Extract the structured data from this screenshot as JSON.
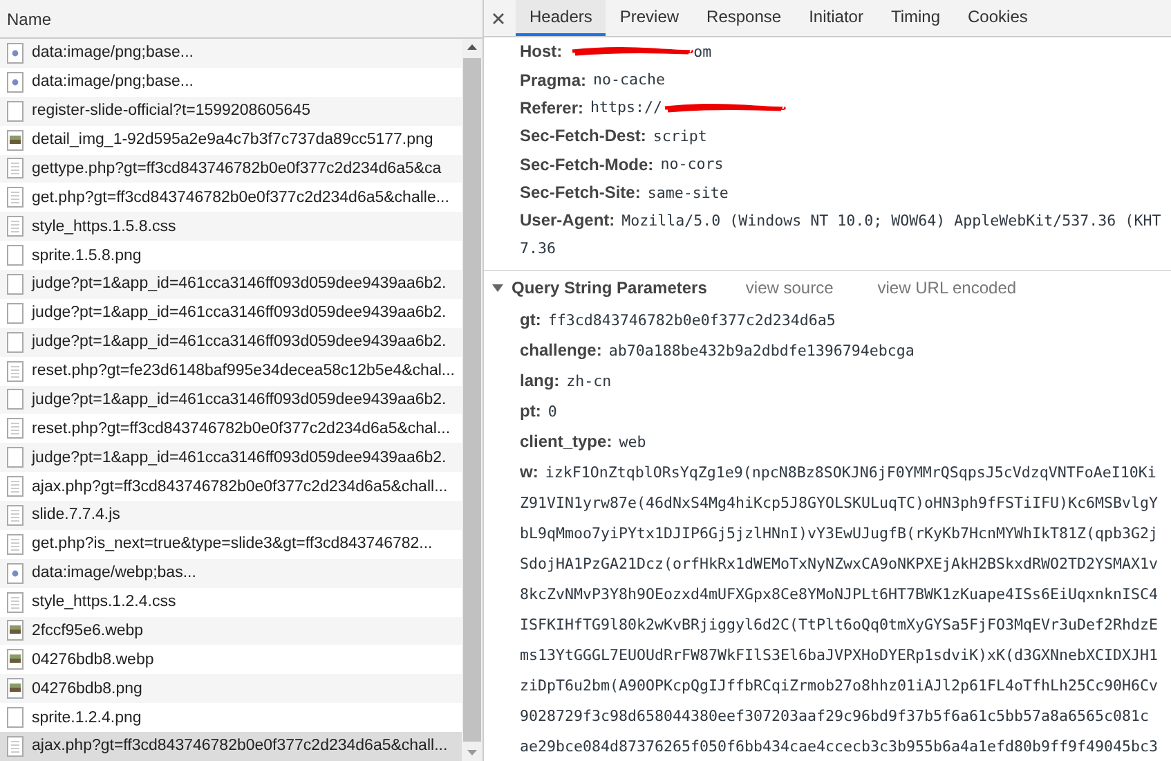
{
  "request_list": {
    "column": "Name",
    "rows": [
      {
        "name": "data:image/png;base...",
        "kind": "dot",
        "selected": false
      },
      {
        "name": "data:image/png;base...",
        "kind": "dot",
        "selected": false
      },
      {
        "name": "register-slide-official?t=1599208605645",
        "kind": "blank",
        "selected": false
      },
      {
        "name": "detail_img_1-92d595a2e9a4c7b3f7c737da89cc5177.png",
        "kind": "image",
        "selected": false
      },
      {
        "name": "gettype.php?gt=ff3cd843746782b0e0f377c2d234d6a5&ca",
        "kind": "document",
        "selected": false
      },
      {
        "name": "get.php?gt=ff3cd843746782b0e0f377c2d234d6a5&challe...",
        "kind": "document",
        "selected": false
      },
      {
        "name": "style_https.1.5.8.css",
        "kind": "document",
        "selected": false
      },
      {
        "name": "sprite.1.5.8.png",
        "kind": "blank",
        "selected": false
      },
      {
        "name": "judge?pt=1&app_id=461cca3146ff093d059dee9439aa6b2.",
        "kind": "blank",
        "selected": false
      },
      {
        "name": "judge?pt=1&app_id=461cca3146ff093d059dee9439aa6b2.",
        "kind": "blank",
        "selected": false
      },
      {
        "name": "judge?pt=1&app_id=461cca3146ff093d059dee9439aa6b2.",
        "kind": "blank",
        "selected": false
      },
      {
        "name": "reset.php?gt=fe23d6148baf995e34decea58c12b5e4&chal...",
        "kind": "document",
        "selected": false
      },
      {
        "name": "judge?pt=1&app_id=461cca3146ff093d059dee9439aa6b2.",
        "kind": "blank",
        "selected": false
      },
      {
        "name": "reset.php?gt=ff3cd843746782b0e0f377c2d234d6a5&chal...",
        "kind": "document",
        "selected": false
      },
      {
        "name": "judge?pt=1&app_id=461cca3146ff093d059dee9439aa6b2.",
        "kind": "blank",
        "selected": false
      },
      {
        "name": "ajax.php?gt=ff3cd843746782b0e0f377c2d234d6a5&chall...",
        "kind": "document",
        "selected": false
      },
      {
        "name": "slide.7.7.4.js",
        "kind": "document",
        "selected": false
      },
      {
        "name": "get.php?is_next=true&type=slide3&gt=ff3cd843746782...",
        "kind": "document",
        "selected": false
      },
      {
        "name": "data:image/webp;bas...",
        "kind": "dot",
        "selected": false
      },
      {
        "name": "style_https.1.2.4.css",
        "kind": "document",
        "selected": false
      },
      {
        "name": "2fccf95e6.webp",
        "kind": "image",
        "selected": false
      },
      {
        "name": "04276bdb8.webp",
        "kind": "image",
        "selected": false
      },
      {
        "name": "04276bdb8.png",
        "kind": "image",
        "selected": false
      },
      {
        "name": "sprite.1.2.4.png",
        "kind": "blank",
        "selected": false
      },
      {
        "name": "ajax.php?gt=ff3cd843746782b0e0f377c2d234d6a5&chall...",
        "kind": "document",
        "selected": true
      }
    ]
  },
  "details": {
    "tabs": [
      {
        "label": "Headers",
        "selected": true
      },
      {
        "label": "Preview",
        "selected": false
      },
      {
        "label": "Response",
        "selected": false
      },
      {
        "label": "Initiator",
        "selected": false
      },
      {
        "label": "Timing",
        "selected": false
      },
      {
        "label": "Cookies",
        "selected": false
      }
    ],
    "request_headers": [
      {
        "key": "Host:",
        "value": "om",
        "redacted_before": true
      },
      {
        "key": "Pragma:",
        "value": "no-cache"
      },
      {
        "key": "Referer:",
        "value": "https://",
        "redacted_after": true
      },
      {
        "key": "Sec-Fetch-Dest:",
        "value": "script"
      },
      {
        "key": "Sec-Fetch-Mode:",
        "value": "no-cors"
      },
      {
        "key": "Sec-Fetch-Site:",
        "value": "same-site"
      },
      {
        "key": "User-Agent:",
        "value": "Mozilla/5.0 (Windows NT 10.0; WOW64) AppleWebKit/537.36 (KHT",
        "continuation": [
          "7.36"
        ]
      }
    ],
    "query_section": {
      "title": "Query String Parameters",
      "expanded": true,
      "links": [
        "view source",
        "view URL encoded"
      ],
      "params": [
        {
          "key": "gt:",
          "value": "ff3cd843746782b0e0f377c2d234d6a5"
        },
        {
          "key": "challenge:",
          "value": "ab70a188be432b9a2dbdfe1396794ebcga"
        },
        {
          "key": "lang:",
          "value": "zh-cn"
        },
        {
          "key": "pt:",
          "value": "0"
        },
        {
          "key": "client_type:",
          "value": "web"
        },
        {
          "key": "w:",
          "value": "izkF1OnZtqblORsYqZg1e9(npcN8Bz8SOKJN6jF0YMMrQSqpsJ5cVdzqVNTFoAeI10Ki",
          "continuation": [
            "Z91VIN1yrw87e(46dNxS4Mg4hiKcp5J8GYOLSKULuqTC)oHN3ph9fFSTiIFU)Kc6MSBvlgY",
            "bL9qMmoo7yiPYtx1DJIP6Gj5jzlHNnI)vY3EwUJugfB(rKyKb7HcnMYWhIkT81Z(qpb3G2j",
            "SdojHA1PzGA21Dcz(orfHkRx1dWEMoTxNyNZwxCA9oNKPXEjAkH2BSkxdRWO2TD2YSMAX1v",
            "8kcZvNMvP3Y8h9OEozxd4mUFXGpx8Ce8YMoNJPLt6HT7BWK1zKuape4ISs6EiUqxnknISC4",
            "ISFKIHfTG9l80k2wKvBRjiggyl6d2C(TtPlt6oQq0tmXyGYSa5FjFO3MqEVr3uDef2RhdzE",
            "ms13YtGGGL7EUOUdRrFW87WkFIlS3El6baJVPXHoDYERp1sdviK)xK(d3GXNnebXCIDXJH1",
            "ziDpT6u2bm(A90OPKcpQgIJffbRCqiZrmob27o8hhz01iAJl2p61FL4oTfhLh25Cc90H6Cv",
            "9028729f3c98d658044380eef307203aaf29c96bd9f37b5f6a61c5bb57a8a6565c081c",
            "ae29bce084d87376265f050f6bb434cae4ccecb3c3b955b6a4a1efd80b9ff9f49045bc3"
          ]
        }
      ]
    }
  }
}
